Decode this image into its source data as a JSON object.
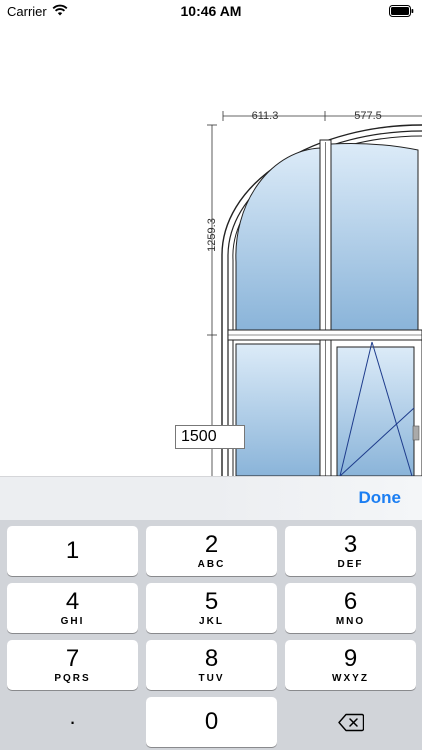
{
  "status_bar": {
    "carrier": "Carrier",
    "time": "10:46 AM",
    "wifi_icon": "wifi-icon",
    "battery_icon": "battery-icon"
  },
  "drawing": {
    "width_dimension_left": "611.3",
    "width_dimension_right": "577.5",
    "height_dimension": "1259.3",
    "glass_color_top": "#dcebf8",
    "glass_color_bottom": "#8ab4d9"
  },
  "input": {
    "value": "1500"
  },
  "accessory": {
    "done_label": "Done"
  },
  "keypad": {
    "keys": [
      {
        "digit": "1",
        "letters": ""
      },
      {
        "digit": "2",
        "letters": "ABC"
      },
      {
        "digit": "3",
        "letters": "DEF"
      },
      {
        "digit": "4",
        "letters": "GHI"
      },
      {
        "digit": "5",
        "letters": "JKL"
      },
      {
        "digit": "6",
        "letters": "MNO"
      },
      {
        "digit": "7",
        "letters": "PQRS"
      },
      {
        "digit": "8",
        "letters": "TUV"
      },
      {
        "digit": "9",
        "letters": "WXYZ"
      },
      {
        "digit": ".",
        "letters": ""
      },
      {
        "digit": "0",
        "letters": ""
      }
    ],
    "delete_icon": "backspace-icon"
  },
  "colors": {
    "accent": "#1b7ef2",
    "keypad_background": "#d1d4d9",
    "key_background": "#ffffff"
  }
}
